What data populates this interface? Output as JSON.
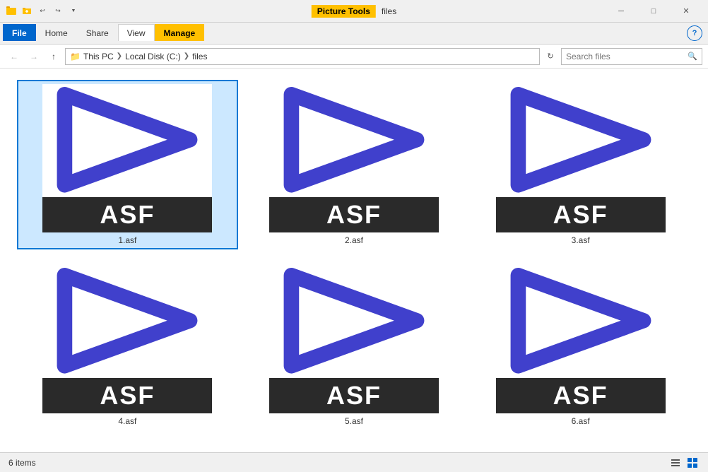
{
  "titleBar": {
    "pictureTools": "Picture Tools",
    "title": "files",
    "minimize": "─",
    "maximize": "□",
    "close": "✕"
  },
  "ribbon": {
    "tabs": [
      {
        "id": "file",
        "label": "File",
        "type": "file"
      },
      {
        "id": "home",
        "label": "Home",
        "type": "normal"
      },
      {
        "id": "share",
        "label": "Share",
        "type": "normal"
      },
      {
        "id": "view",
        "label": "View",
        "type": "normal"
      },
      {
        "id": "manage",
        "label": "Manage",
        "type": "manage"
      }
    ],
    "helpLabel": "?"
  },
  "addressBar": {
    "backTitle": "Back",
    "forwardTitle": "Forward",
    "upTitle": "Up",
    "pathParts": [
      "This PC",
      "Local Disk (C:)",
      "files"
    ],
    "refreshTitle": "Refresh",
    "searchPlaceholder": "Search files"
  },
  "files": [
    {
      "id": 1,
      "name": "1.asf",
      "label": "ASF",
      "selected": true
    },
    {
      "id": 2,
      "name": "2.asf",
      "label": "ASF",
      "selected": false
    },
    {
      "id": 3,
      "name": "3.asf",
      "label": "ASF",
      "selected": false
    },
    {
      "id": 4,
      "name": "4.asf",
      "label": "ASF",
      "selected": false
    },
    {
      "id": 5,
      "name": "5.asf",
      "label": "ASF",
      "selected": false
    },
    {
      "id": 6,
      "name": "6.asf",
      "label": "ASF",
      "selected": false
    }
  ],
  "statusBar": {
    "itemCount": "6 items"
  },
  "colors": {
    "accent": "#0066cc",
    "pictureToolsBg": "#ffc000",
    "playIconColor": "#4040cc",
    "playIconStroke": "#3333bb"
  }
}
